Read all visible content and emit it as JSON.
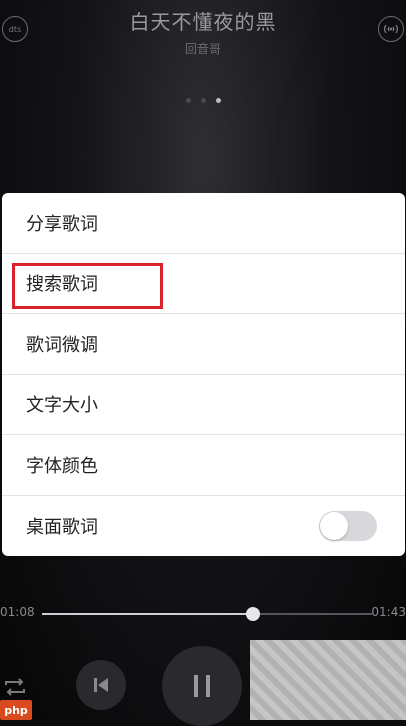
{
  "player": {
    "song_title": "白天不懂夜的黑",
    "artist": "回音哥",
    "left_badge": "dts",
    "page_dots": 3,
    "active_dot": 2
  },
  "menu": {
    "items": [
      {
        "label": "分享歌词",
        "highlighted": false
      },
      {
        "label": "搜索歌词",
        "highlighted": true
      },
      {
        "label": "歌词微调",
        "highlighted": false
      },
      {
        "label": "文字大小",
        "highlighted": false
      },
      {
        "label": "字体颜色",
        "highlighted": false
      },
      {
        "label": "桌面歌词",
        "highlighted": false,
        "toggle": false
      }
    ]
  },
  "progress": {
    "current_time": "01:08",
    "total_time": "01:43",
    "fraction": 0.64
  },
  "colors": {
    "highlight": "#d9232a",
    "menu_bg": "#ffffff",
    "background": "#0b0b0d"
  },
  "watermark": {
    "logo_text": "php"
  }
}
